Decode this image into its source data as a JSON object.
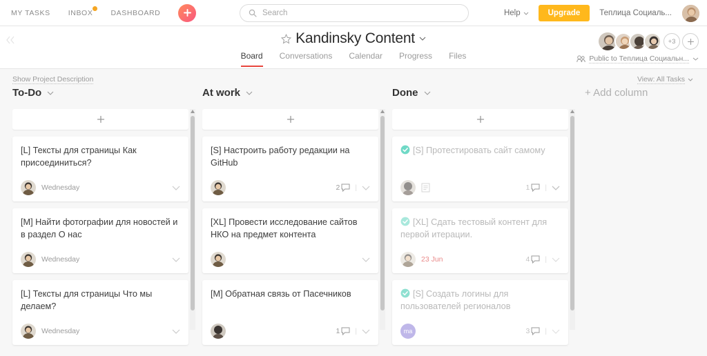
{
  "topbar": {
    "nav": [
      {
        "label": "MY TASKS",
        "notification": false
      },
      {
        "label": "INBOX",
        "notification": true
      },
      {
        "label": "DASHBOARD",
        "notification": false
      }
    ],
    "add_button_icon": "plus-icon",
    "search": {
      "placeholder": "Search",
      "value": "",
      "icon": "search-icon"
    },
    "help_label": "Help",
    "upgrade_label": "Upgrade",
    "org_name": "Теплица Социаль...",
    "user_avatar": "user-avatar"
  },
  "project": {
    "star_icon": "star-icon",
    "title": "Kandinsky Content",
    "title_chevron": "chevron-down-icon",
    "tabs": [
      {
        "label": "Board",
        "active": true
      },
      {
        "label": "Conversations",
        "active": false
      },
      {
        "label": "Calendar",
        "active": false
      },
      {
        "label": "Progress",
        "active": false
      },
      {
        "label": "Files",
        "active": false
      }
    ],
    "members_overflow": "+3",
    "add_member_label": "+",
    "share_label": "Public to Теплица Социальн...",
    "share_icon": "people-icon"
  },
  "board": {
    "show_description_label": "Show Project Description",
    "view_label": "View: All Tasks",
    "add_column_label": "+ Add column",
    "add_card_icon": "plus-icon",
    "columns": [
      {
        "name": "To-Do",
        "cards": [
          {
            "title": "[L] Тексты для страницы Как присоединиться?",
            "date": "Wednesday",
            "comments": "",
            "done": false,
            "avatar_type": "photo",
            "has_note": false
          },
          {
            "title": "[M] Найти фотографии для новостей и в раздел О нас",
            "date": "Wednesday",
            "comments": "",
            "done": false,
            "avatar_type": "photo",
            "has_note": false
          },
          {
            "title": "[L] Тексты для страницы Что мы делаем?",
            "date": "Wednesday",
            "comments": "",
            "done": false,
            "avatar_type": "photo",
            "has_note": false
          }
        ]
      },
      {
        "name": "At work",
        "cards": [
          {
            "title": "[S] Настроить работу редакции на GitHub",
            "date": "",
            "comments": "2",
            "done": false,
            "avatar_type": "photo",
            "has_note": false
          },
          {
            "title": "[XL] Провести исследование сайтов НКО на предмет контента",
            "date": "",
            "comments": "",
            "done": false,
            "avatar_type": "photo",
            "has_note": false
          },
          {
            "title": "[M] Обратная связь от Пасечников",
            "date": "",
            "comments": "1",
            "done": false,
            "avatar_type": "dark",
            "has_note": false
          }
        ]
      },
      {
        "name": "Done",
        "cards": [
          {
            "title": "[S] Протестировать сайт самому",
            "date": "",
            "comments": "1",
            "done": true,
            "avatar_type": "dark",
            "has_note": true
          },
          {
            "title": "[XL] Сдать тестовый контент для первой итерации.",
            "date": "23 Jun",
            "date_overdue": true,
            "comments": "4",
            "done": true,
            "avatar_type": "photo",
            "has_note": false
          },
          {
            "title": "[S] Создать логины для пользователей регионалов",
            "date": "",
            "comments": "3",
            "done": true,
            "avatar_type": "initials",
            "avatar_initials": "ma",
            "has_note": false
          }
        ]
      }
    ]
  },
  "colors": {
    "accent_red": "#e8453c",
    "upgrade_yellow": "#ffb81c",
    "done_check": "#6fd9c6",
    "overdue": "#e98a8a",
    "initials_avatar": "#8b7dd8",
    "notification_dot": "#f5a623",
    "board_bg": "#f7f7f7"
  }
}
